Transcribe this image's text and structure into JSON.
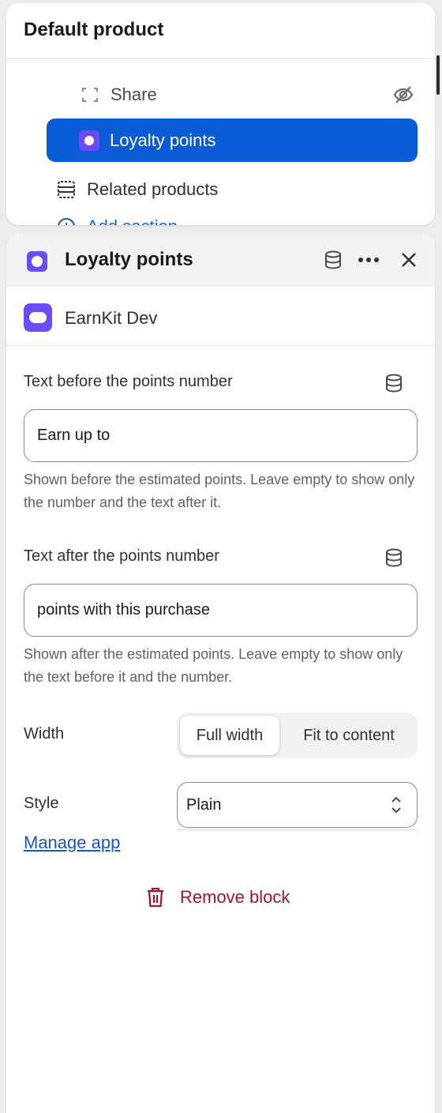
{
  "section": {
    "title": "Default product",
    "items": [
      {
        "label": "Share",
        "icon": "share-dashed-icon",
        "hidden": true
      },
      {
        "label": "Loyalty points",
        "icon": "app-block-icon",
        "selected": true
      },
      {
        "label": "Related products",
        "icon": "section-icon"
      },
      {
        "label": "Add section",
        "icon": "plus-circle-icon"
      }
    ]
  },
  "panel": {
    "title": "Loyalty points",
    "app_name": "EarnKit Dev"
  },
  "fields": {
    "before": {
      "label": "Text before the points number",
      "value": "Earn up to",
      "help": "Shown before the estimated points. Leave empty to show only the number and the text after it."
    },
    "after": {
      "label": "Text after the points number",
      "value": "points with this purchase",
      "help": "Shown after the estimated points. Leave empty to show only the text before it and the number."
    },
    "width": {
      "label": "Width",
      "options": [
        "Full width",
        "Fit to content"
      ],
      "selected": "Full width"
    },
    "style": {
      "label": "Style",
      "value": "Plain"
    }
  },
  "manage_link": "Manage app",
  "remove_label": "Remove block",
  "colors": {
    "selected_row": "#0a5bd6",
    "app_icon": "#6b4cf6",
    "link": "#1756c4",
    "danger": "#a0152a"
  }
}
